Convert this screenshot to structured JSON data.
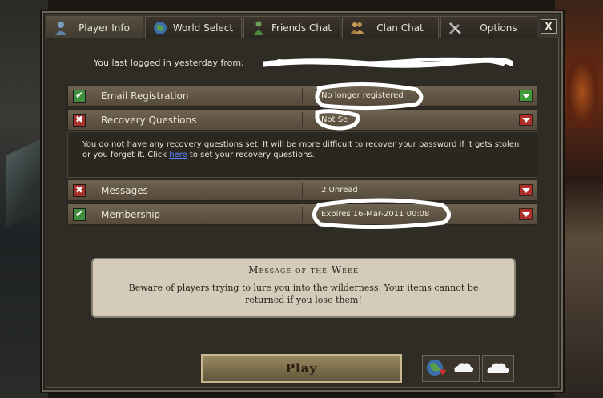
{
  "tabs": [
    {
      "label": "Player Info",
      "icon": "player-icon",
      "active": true
    },
    {
      "label": "World Select",
      "icon": "globe-icon",
      "active": false
    },
    {
      "label": "Friends Chat",
      "icon": "friends-icon",
      "active": false
    },
    {
      "label": "Clan Chat",
      "icon": "clan-icon",
      "active": false
    },
    {
      "label": "Options",
      "icon": "tools-icon",
      "active": false
    }
  ],
  "close_label": "X",
  "last_login": "You last logged in yesterday from:",
  "rows": [
    {
      "status": "ok",
      "label": "Email Registration",
      "value": "No longer registered"
    },
    {
      "status": "bad",
      "label": "Recovery Questions",
      "value": "Not Se"
    },
    {
      "status": "bad",
      "label": "Messages",
      "value": "2 Unread"
    },
    {
      "status": "ok",
      "label": "Membership",
      "value": "Expires 16-Mar-2011 00:08"
    }
  ],
  "recovery_info": {
    "before": "You do not have any recovery questions set. It will be more difficult to recover your password if it gets stolen or you forget it. Click ",
    "link": "here",
    "after": " to set your recovery questions."
  },
  "motw": {
    "title": "Message of the Week",
    "body": "Beware of players trying to lure you into the wilderness. Your items cannot be returned if you lose them!"
  },
  "play_label": "Play",
  "colors": {
    "ok": "#3f8f3c",
    "bad": "#a8302a",
    "panel": "#2f2b25",
    "row": "#6f6351",
    "motw": "#d4cbba"
  },
  "icons": {
    "ok": "checkmark-icon",
    "bad": "cross-icon",
    "dropdown": "chevron-down-icon"
  }
}
